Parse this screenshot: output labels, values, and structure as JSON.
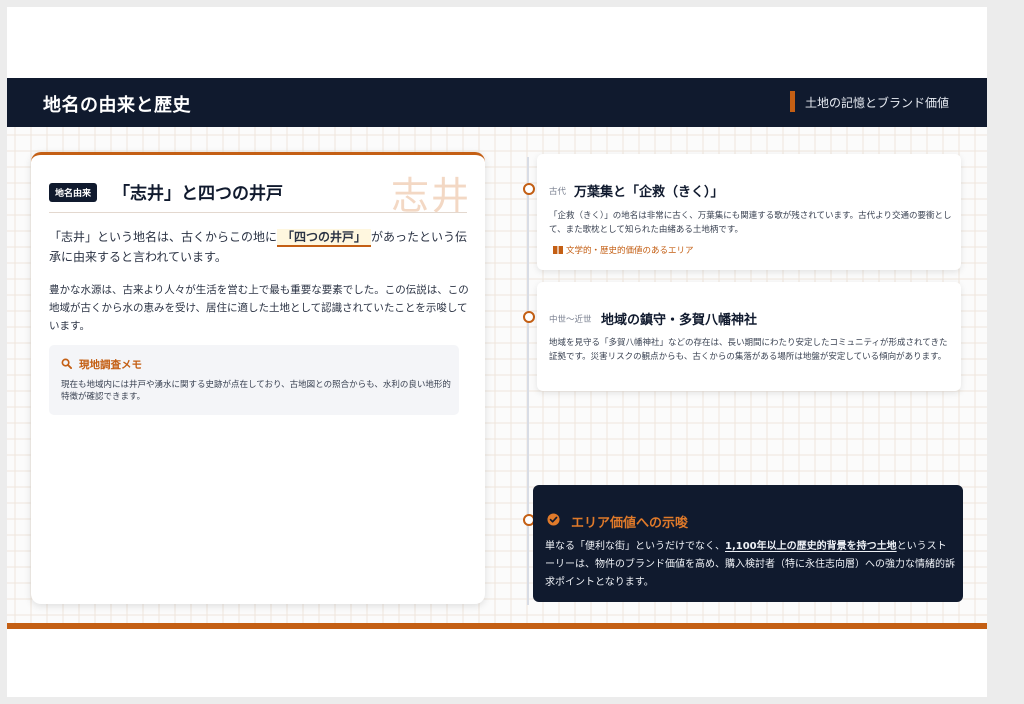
{
  "header": {
    "title": "地名の由来と歴史",
    "subtitle": "土地の記憶とブランド価値"
  },
  "origin_card": {
    "badge": "地名由来",
    "title": "「志井」と四つの井戸",
    "watermark": "志井",
    "lead_before": "「志井」という地名は、古くからこの地に",
    "lead_highlight": "「四つの井戸」",
    "lead_after": "があったという伝承に由来すると言われています。",
    "body": "豊かな水源は、古来より人々が生活を営む上で最も重要な要素でした。この伝説は、この地域が古くから水の恵みを受け、居住に適した土地として認識されていたことを示唆しています。",
    "memo": {
      "icon": "magnifier-icon",
      "title": "現地調査メモ",
      "text": "現在も地域内には井戸や湧水に関する史跡が点在しており、古地図との照合からも、水利の良い地形的特徴が確認できます。"
    }
  },
  "timeline": [
    {
      "era": "古代",
      "title": "万葉集と「企救（きく）」",
      "text": "「企救（きく）」の地名は非常に古く、万葉集にも関連する歌が残されています。古代より交通の要衝として、また歌枕として知られた由緒ある土地柄です。",
      "tag": "文学的・歴史的価値のあるエリア",
      "tag_icon": "book-icon"
    },
    {
      "era": "中世〜近世",
      "title": "地域の鎮守・多賀八幡神社",
      "text": "地域を見守る「多賀八幡神社」などの存在は、長い期間にわたり安定したコミュニティが形成されてきた証拠です。災害リスクの観点からも、古くからの集落がある場所は地盤が安定している傾向があります。"
    }
  ],
  "implication": {
    "icon": "check-circle-icon",
    "title": "エリア価値への示唆",
    "text_before": "単なる「便利な街」というだけでなく、",
    "text_strong": "1,100年以上の歴史的背景を持つ土地",
    "text_after": "というストーリーは、物件のブランド価値を高め、購入検討者（特に永住志向層）への強力な情緒的訴求ポイントとなります。"
  },
  "colors": {
    "navy": "#101a2e",
    "accent": "#c45f14"
  }
}
